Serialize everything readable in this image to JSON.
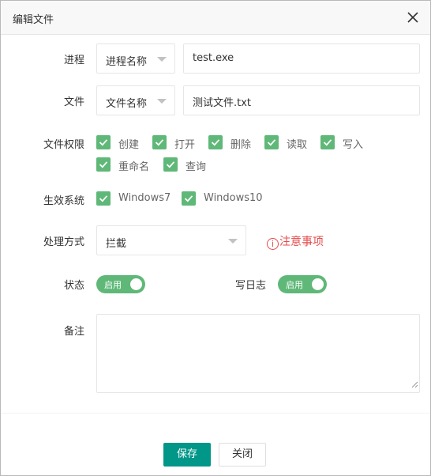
{
  "dialog": {
    "title": "编辑文件",
    "close_icon": "close-icon"
  },
  "form": {
    "process": {
      "label": "进程",
      "type_select": "进程名称",
      "value": "test.exe"
    },
    "file": {
      "label": "文件",
      "type_select": "文件名称",
      "value": "测试文件.txt"
    },
    "permissions": {
      "label": "文件权限",
      "options": [
        {
          "label": "创建",
          "checked": true
        },
        {
          "label": "打开",
          "checked": true
        },
        {
          "label": "删除",
          "checked": true
        },
        {
          "label": "读取",
          "checked": true
        },
        {
          "label": "写入",
          "checked": true
        },
        {
          "label": "重命名",
          "checked": true
        },
        {
          "label": "查询",
          "checked": true
        }
      ]
    },
    "systems": {
      "label": "生效系统",
      "options": [
        {
          "label": "Windows7",
          "checked": true
        },
        {
          "label": "Windows10",
          "checked": true
        }
      ]
    },
    "handling": {
      "label": "处理方式",
      "value": "拦截",
      "notice": "注意事项",
      "notice_icon_glyph": "i"
    },
    "status": {
      "label": "状态",
      "switch_text": "启用",
      "on": true
    },
    "log": {
      "label": "写日志",
      "switch_text": "启用",
      "on": true
    },
    "remark": {
      "label": "备注",
      "value": ""
    }
  },
  "footer": {
    "save_label": "保存",
    "close_label": "关闭"
  },
  "colors": {
    "checkbox_green": "#5fb878",
    "primary_button": "#009688",
    "notice_red": "#e54c4c"
  }
}
